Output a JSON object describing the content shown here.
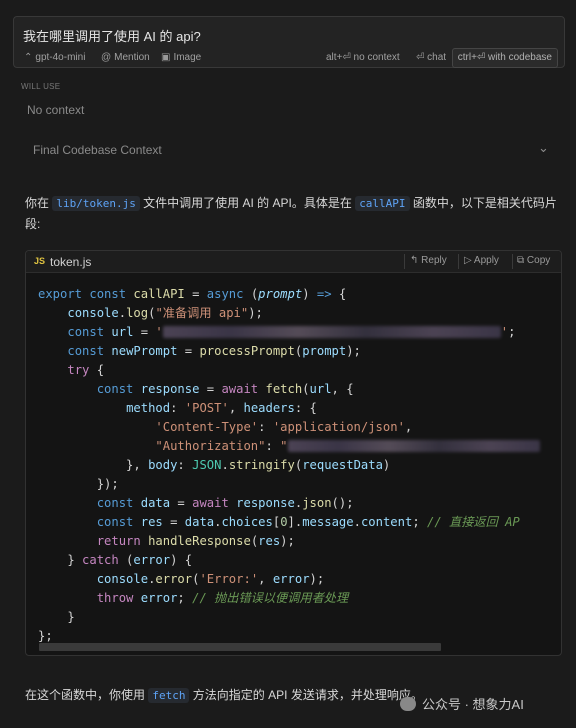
{
  "prompt": {
    "text": "我在哪里调用了使用 AI 的 api?",
    "model": "gpt-4o-mini",
    "mention": "Mention",
    "image": "Image",
    "no_context": "alt+⏎ no context",
    "chat": "⏎ chat",
    "with_codebase": "ctrl+⏎ with codebase"
  },
  "context": {
    "will_use_label": "WILL USE",
    "no_context": "No context",
    "final_codebase": "Final Codebase Context"
  },
  "answer": {
    "intro_1": "你在 ",
    "intro_file": "lib/token.js",
    "intro_2": " 文件中调用了使用 AI 的 API。具体是在 ",
    "intro_fn": "callAPI",
    "intro_3": " 函数中，以下是相关代码片段:",
    "outro_1": "在这个函数中，你使用 ",
    "outro_fn": "fetch",
    "outro_2": " 方法向指定的 API 发送请求，并处理响应。"
  },
  "code_block": {
    "badge": "JS",
    "filename": "token.js",
    "reply": "Reply",
    "apply": "Apply",
    "copy": "Copy",
    "lines": {
      "l1_kw": "export const",
      "l1_fn": "callAPI",
      "l1_kw2": "async",
      "l1_param": "prompt",
      "l2_obj": "console",
      "l2_fn": "log",
      "l2_str": "\"准备调用 api\"",
      "l3_kw": "const",
      "l3_var": "url",
      "l4_kw": "const",
      "l4_var": "newPrompt",
      "l4_fn": "processPrompt",
      "l4_arg": "prompt",
      "l5_kw": "try",
      "l6_kw": "const",
      "l6_var": "response",
      "l6_await": "await",
      "l6_fn": "fetch",
      "l6_arg": "url",
      "l7_prop": "method",
      "l7_str": "'POST'",
      "l7_prop2": "headers",
      "l8_key": "'Content-Type'",
      "l8_val": "'application/json'",
      "l9_key": "\"Authorization\"",
      "l10_prop": "body",
      "l10_obj": "JSON",
      "l10_fn": "stringify",
      "l10_arg": "requestData",
      "l12_kw": "const",
      "l12_var": "data",
      "l12_await": "await",
      "l12_obj": "response",
      "l12_fn": "json",
      "l13_kw": "const",
      "l13_var": "res",
      "l13_obj": "data",
      "l13_p1": "choices",
      "l13_idx": "0",
      "l13_p2": "message",
      "l13_p3": "content",
      "l13_comment": "// 直接返回 AP",
      "l14_kw": "return",
      "l14_fn": "handleResponse",
      "l14_arg": "res",
      "l15_kw": "catch",
      "l15_arg": "error",
      "l16_obj": "console",
      "l16_fn": "error",
      "l16_str": "'Error:'",
      "l16_arg": "error",
      "l17_kw": "throw",
      "l17_arg": "error",
      "l17_comment": "// 抛出错误以便调用者处理"
    }
  },
  "watermark": "公众号 · 想象力AI",
  "colors": {
    "background": "#1b1b1b",
    "inline_code": "#5ea3f6",
    "keyword": "#569cd6",
    "function": "#dcdcaa",
    "string": "#ce9178",
    "comment": "#6a9955"
  }
}
